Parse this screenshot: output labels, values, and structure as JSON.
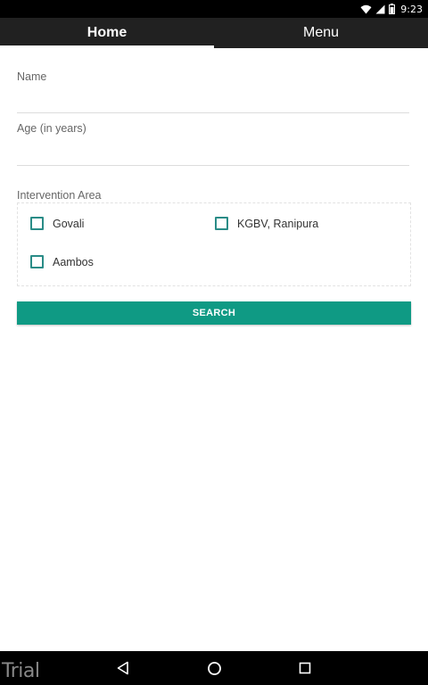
{
  "status_bar": {
    "time": "9:23",
    "icons": [
      "wifi-icon",
      "signal-icon",
      "battery-icon"
    ]
  },
  "tabs": [
    {
      "label": "Home",
      "active": true
    },
    {
      "label": "Menu",
      "active": false
    }
  ],
  "form": {
    "name": {
      "label": "Name",
      "value": ""
    },
    "age": {
      "label": "Age (in years)",
      "value": ""
    },
    "intervention_area": {
      "label": "Intervention Area",
      "options": [
        {
          "label": "Govali",
          "checked": false
        },
        {
          "label": "KGBV, Ranipura",
          "checked": false
        },
        {
          "label": "Aambos",
          "checked": false
        }
      ]
    },
    "search_label": "SEARCH"
  },
  "navbar": {
    "icons": [
      "back-icon",
      "home-icon",
      "recents-icon"
    ]
  },
  "watermark": "Trial",
  "colors": {
    "tab_bar": "#212121",
    "accent": "#0f9a84",
    "checkbox": "#2a8c87"
  }
}
